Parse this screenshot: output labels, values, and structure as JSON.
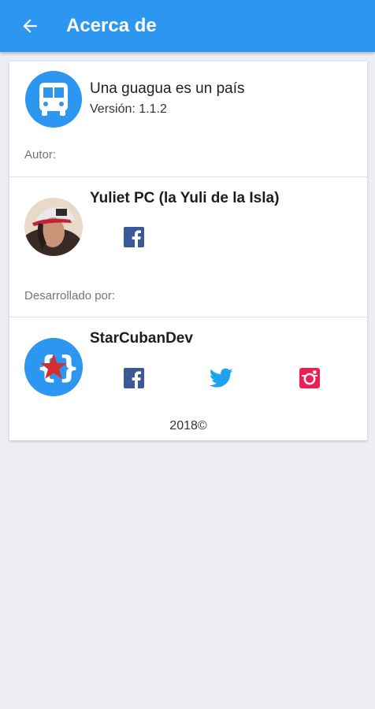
{
  "appbar": {
    "title": "Acerca de",
    "back_icon": "arrow-back-icon"
  },
  "app_info": {
    "name": "Una guagua es un país",
    "version": "Versión: 1.1.2",
    "logo_icon": "bus-icon"
  },
  "author": {
    "section_label": "Autor:",
    "name": "Yuliet PC (la Yuli de la Isla)",
    "links": [
      "facebook-icon"
    ]
  },
  "developer": {
    "section_label": "Desarrollado por:",
    "name": "StarCubanDev",
    "links": [
      "facebook-icon",
      "twitter-icon",
      "instagram-icon"
    ]
  },
  "footer": {
    "copyright": "2018©"
  },
  "colors": {
    "primary": "#2d96f0",
    "facebook": "#3b5998",
    "twitter": "#1da1f2",
    "instagram": "#ec1e52",
    "star": "#d32f2f"
  }
}
